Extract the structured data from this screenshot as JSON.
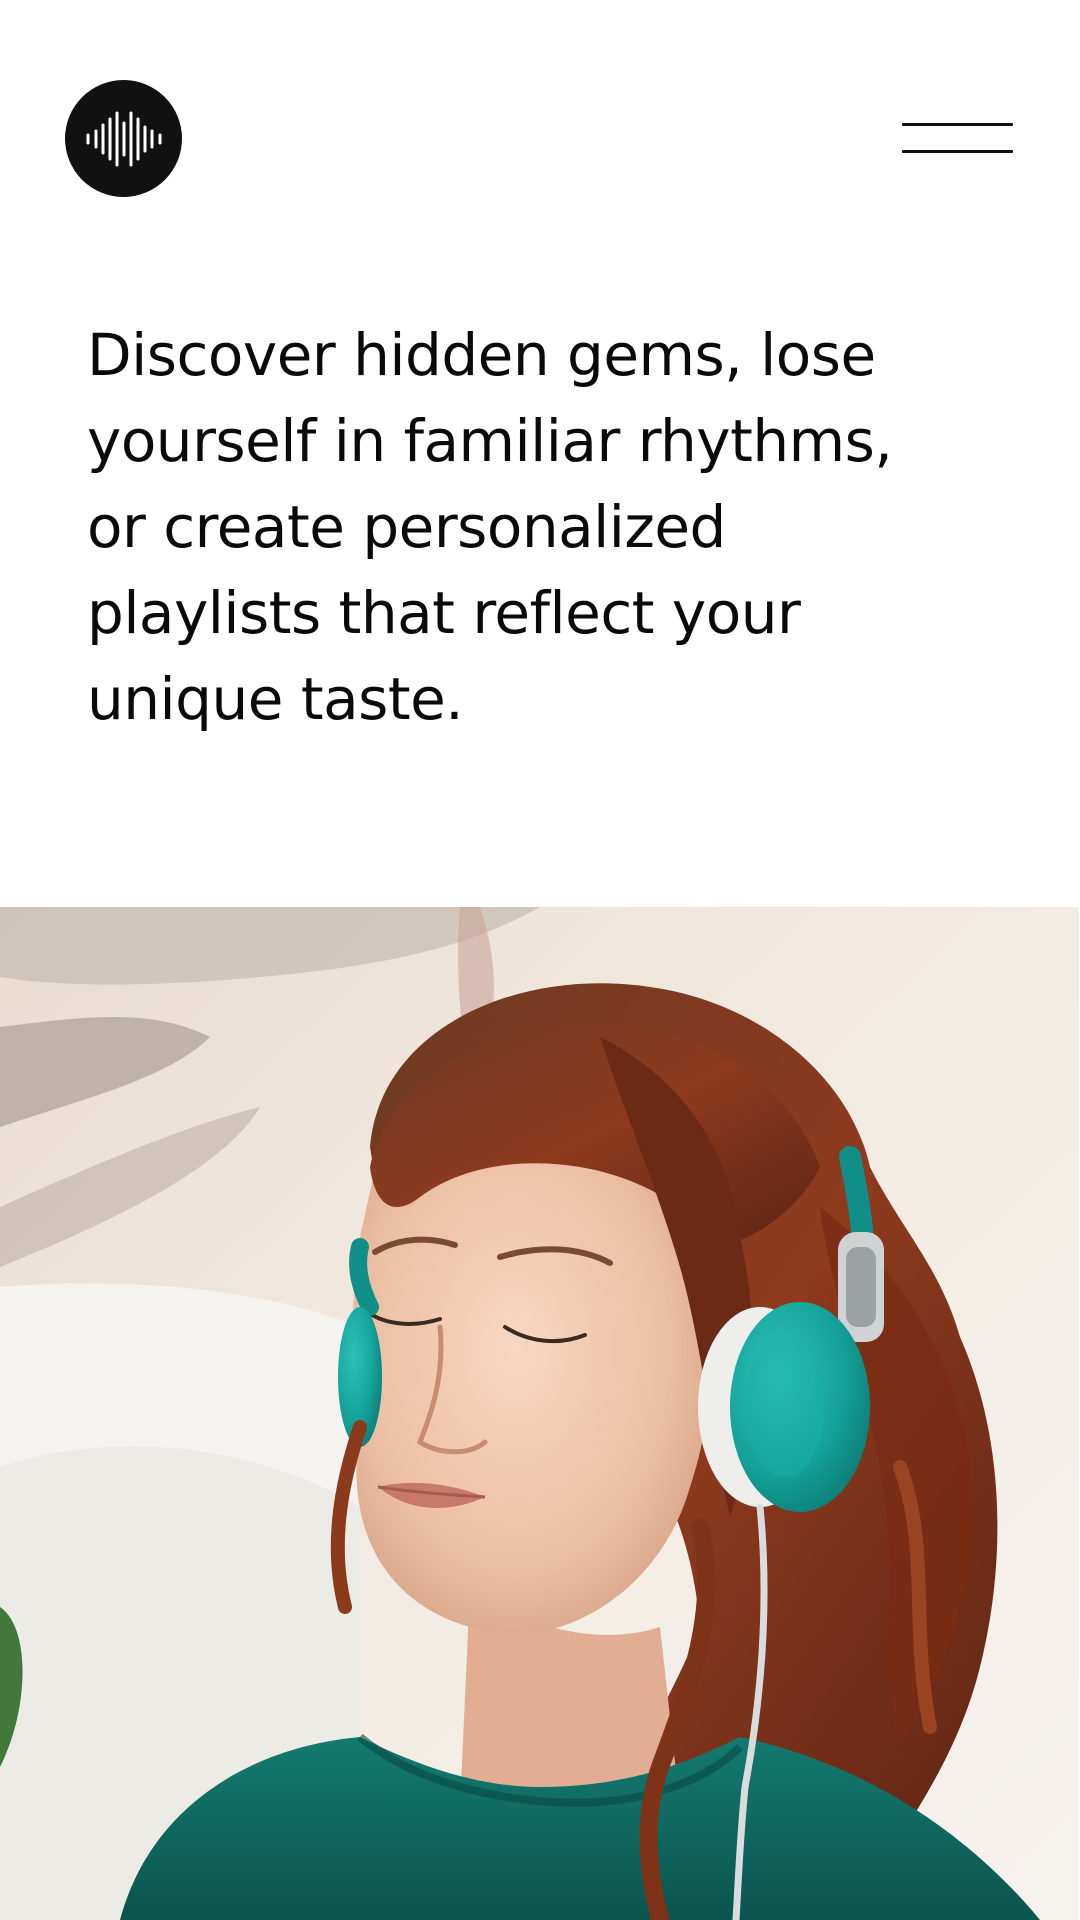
{
  "header": {
    "logo_icon": "soundwave-icon",
    "menu_icon": "hamburger-menu-icon"
  },
  "hero": {
    "headline_lines": [
      "Discover hidden gems, lose",
      "yourself in familiar rhythms,",
      "or create personalized",
      "playlists that reflect your",
      "unique taste."
    ]
  },
  "photo": {
    "subject": "woman-with-headphones-photo",
    "colors": {
      "headphones": "#14a39b",
      "sweater": "#0f6b62",
      "hair": "#8e3a1d",
      "skin": "#f0c7ad",
      "background": "#efe6dc"
    }
  }
}
